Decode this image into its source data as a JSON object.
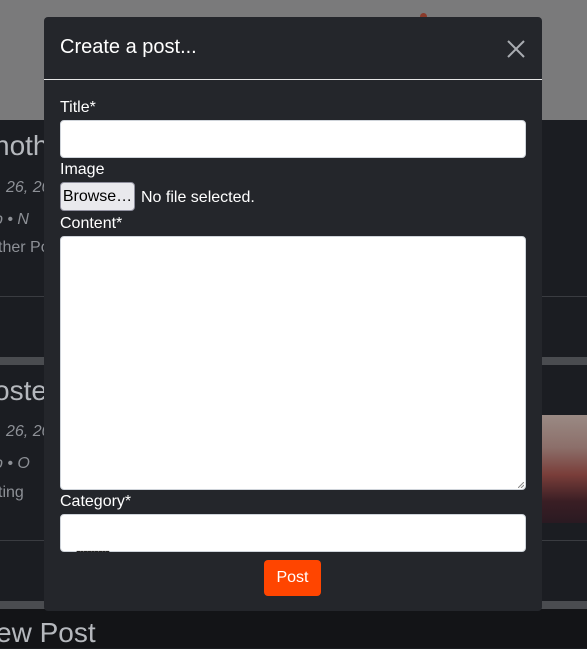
{
  "background": {
    "post1": {
      "title": "noth",
      "date": "26, 20",
      "author": "b • N",
      "snippet": "ther Po"
    },
    "post2": {
      "title": "oste",
      "date": "26, 20",
      "author": "b • O",
      "snippet": "ting"
    },
    "post3": {
      "title": "ew Post"
    }
  },
  "modal": {
    "title": "Create a post...",
    "close_icon": "close-icon",
    "fields": {
      "title_label": "Title*",
      "title_value": "",
      "image_label": "Image",
      "browse_label": "Browse…",
      "file_status": "No file selected.",
      "content_label": "Content*",
      "content_value": "",
      "category_label": "Category*",
      "category_value": "---------"
    },
    "submit_label": "Post"
  },
  "colors": {
    "accent": "#ff4500",
    "modal_bg": "#24262b"
  }
}
